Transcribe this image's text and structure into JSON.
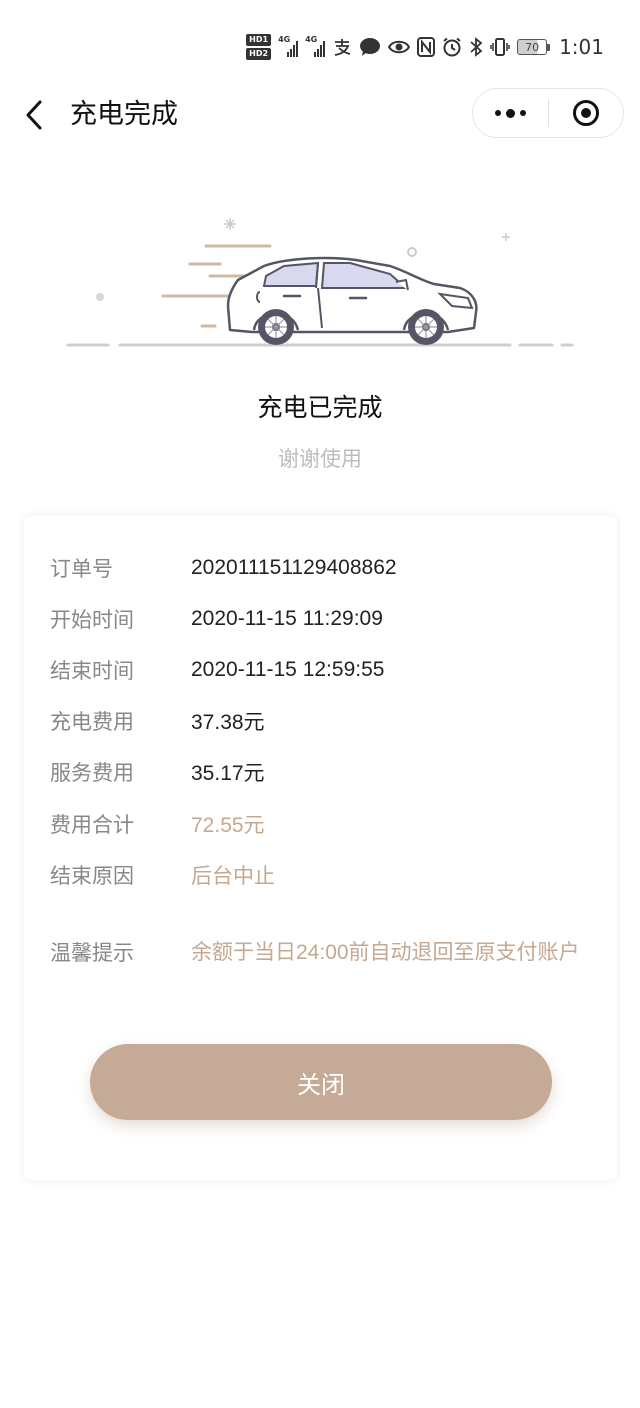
{
  "status_bar": {
    "hd1": "HD1",
    "hd2": "HD2",
    "net1": "4G",
    "net2": "4G",
    "battery": "70",
    "time": "1:01",
    "icons": [
      "hd-badge-icon",
      "signal-icon",
      "alipay-icon",
      "wechat-icon",
      "eye-icon",
      "nfc-icon",
      "alarm-icon",
      "bluetooth-icon",
      "vibrate-icon",
      "battery-icon"
    ]
  },
  "nav": {
    "title": "充电完成",
    "back_icon": "chevron-left-icon",
    "more_icon": "more-dots-icon",
    "close_icon": "target-circle-icon"
  },
  "result": {
    "title": "充电已完成",
    "subtitle": "谢谢使用"
  },
  "details": {
    "order_no": {
      "label": "订单号",
      "value": "202011151129408862"
    },
    "start_time": {
      "label": "开始时间",
      "value": "2020-11-15 11:29:09"
    },
    "end_time": {
      "label": "结束时间",
      "value": "2020-11-15 12:59:55"
    },
    "charge_fee": {
      "label": "充电费用",
      "value": "37.38元"
    },
    "service_fee": {
      "label": "服务费用",
      "value": "35.17元"
    },
    "total_fee": {
      "label": "费用合计",
      "value": "72.55元"
    },
    "end_reason": {
      "label": "结束原因",
      "value": "后台中止"
    },
    "tip": {
      "label": "温馨提示",
      "value": "余额于当日24:00前自动退回至原支付账户"
    }
  },
  "actions": {
    "close_label": "关闭"
  },
  "colors": {
    "accent": "#c4a890",
    "button": "#c4aa97",
    "label": "#888888",
    "car_body": "#ffffff",
    "car_window": "#d8d9ee",
    "car_outline": "#555566"
  }
}
